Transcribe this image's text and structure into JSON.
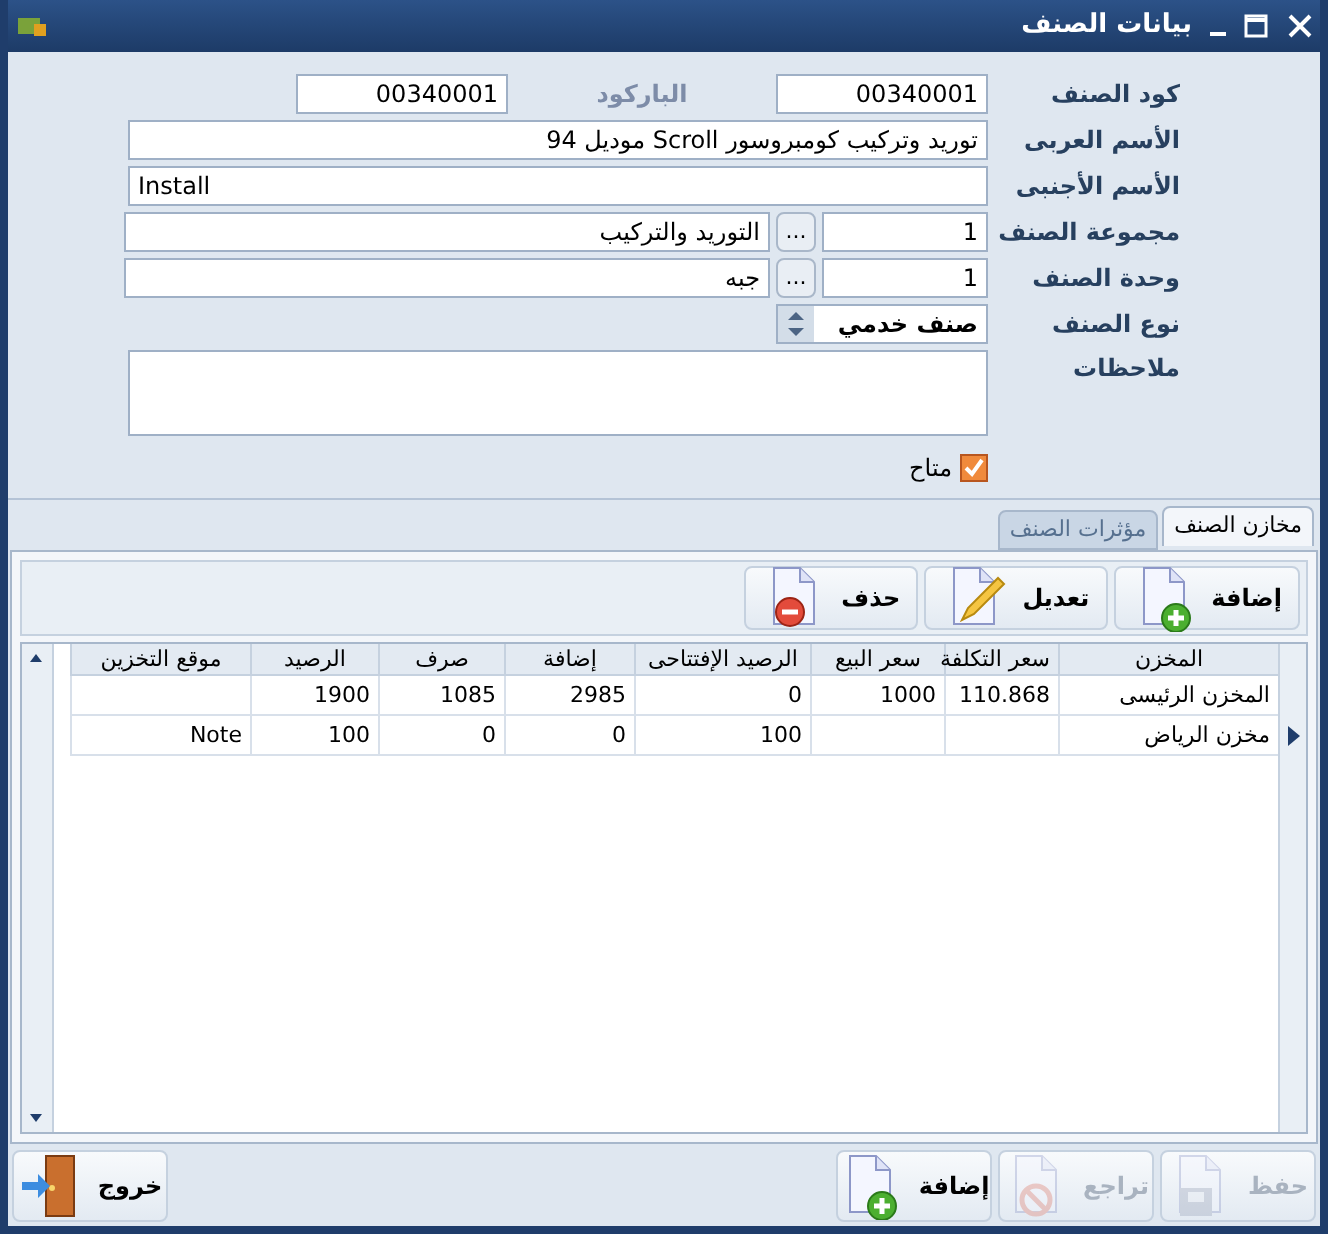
{
  "window": {
    "title": "بيانات الصنف"
  },
  "fields": [
    {
      "kind": "code_pair",
      "label": "كود الصنف",
      "value": "00340001",
      "label_2": "الباركود",
      "value_2": "00340001"
    },
    {
      "kind": "text",
      "label": "الأسم العربى",
      "value": "توريد وتركيب كومبروسور Scroll موديل 94"
    },
    {
      "kind": "text",
      "label": "الأسم الأجنبى",
      "value": "Install"
    },
    {
      "kind": "lookup",
      "label": "مجموعة الصنف",
      "code": "1",
      "button": "...",
      "name": "التوريد والتركيب"
    },
    {
      "kind": "lookup",
      "label": "وحدة الصنف",
      "code": "1",
      "button": "...",
      "name": "جبه"
    },
    {
      "kind": "select",
      "label": "نوع الصنف",
      "value": "صنف خدمي"
    },
    {
      "kind": "memo",
      "label": "ملاحظات"
    },
    {
      "kind": "checkbox",
      "label": "متاح",
      "checked": true
    }
  ],
  "tabs": [
    {
      "label": "مخازن الصنف",
      "selected": true
    },
    {
      "label": "مؤثرات الصنف",
      "selected": false
    }
  ],
  "toolbar": [
    {
      "kind": "add",
      "label": "إضافة"
    },
    {
      "kind": "edit",
      "label": "تعديل"
    },
    {
      "kind": "delete",
      "label": "حذف"
    }
  ],
  "table": {
    "columns": [
      "المخزن",
      "سعر التكلفة",
      "سعر البيع",
      "الرصيد الإفتتاحى",
      "إضافة",
      "صرف",
      "الرصيد",
      "موقع التخزين"
    ],
    "rows": [
      {
        "selected": false,
        "cells": [
          "المخزن الرئيسى",
          "110.868",
          "1000",
          "0",
          "2985",
          "1085",
          "1900",
          ""
        ]
      },
      {
        "selected": true,
        "cells": [
          "مخزن الرياض",
          "",
          "",
          "100",
          "0",
          "0",
          "100",
          "Note"
        ]
      }
    ]
  },
  "footer": [
    {
      "kind": "save",
      "label": "حفظ",
      "disabled": true
    },
    {
      "kind": "undo",
      "label": "تراجع",
      "disabled": true
    },
    {
      "kind": "add",
      "label": "إضافة",
      "disabled": false
    },
    {
      "kind": "exit",
      "label": "خروج",
      "disabled": false
    }
  ]
}
